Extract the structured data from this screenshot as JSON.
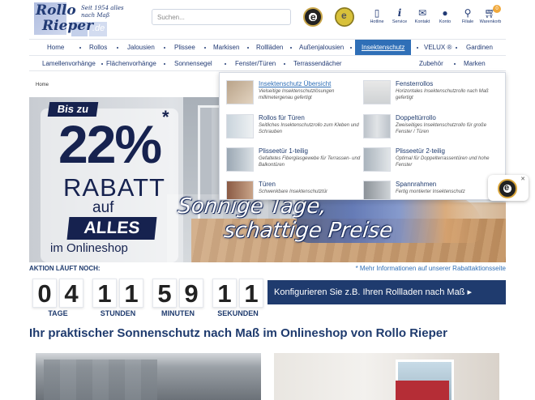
{
  "header": {
    "logo_line1": "Rollo",
    "logo_line2": "Rieper",
    "logo_tld": ".de",
    "logo_since": "Seit 1954 alles nach Maß",
    "search_placeholder": "Suchen...",
    "icons": [
      {
        "icon": "phone-icon",
        "label": "Hotline"
      },
      {
        "icon": "info-icon",
        "label": "Service"
      },
      {
        "icon": "mail-icon",
        "label": "Kontakt"
      },
      {
        "icon": "user-icon",
        "label": "Konto"
      },
      {
        "icon": "location-pin-icon",
        "label": "Filiale"
      },
      {
        "icon": "cart-icon",
        "label": "Warenkorb"
      }
    ],
    "cart_count": "0"
  },
  "nav_main": [
    "Home",
    "Rollos",
    "Jalousien",
    "Plissee",
    "Markisen",
    "Rollläden",
    "Außenjalousien",
    "Insektenschutz",
    "VELUX ®",
    "Gardinen"
  ],
  "nav_sub": [
    "Lamellenvorhänge",
    "Flächenvorhänge",
    "Sonnensegel",
    "Fenster/Türen",
    "Terrassendächer",
    "Zubehör",
    "Marken"
  ],
  "breadcrumb": "Home",
  "dropdown": [
    {
      "title": "Insektenschutz Übersicht",
      "desc": "Vielseitige Insektenschutzlösungen millimetergenau gefertigt"
    },
    {
      "title": "Fensterrollos",
      "desc": "Horizontales Insektenschutzrollo nach Maß gefertigt"
    },
    {
      "title": "Rollos für Türen",
      "desc": "Seitliches Insektenschutzrollo zum Kleben und Schrauben"
    },
    {
      "title": "Doppeltürrollo",
      "desc": "Zweiseitiges Insektenschutzrollo für große Fenster / Türen"
    },
    {
      "title": "Plisseetür 1-teilig",
      "desc": "Gefaltetes Fiberglasgewebe für Terrassen- und Balkontüren"
    },
    {
      "title": "Plisseetür 2-teilig",
      "desc": "Optimal für Doppelterrassentüren und hohe Fenster"
    },
    {
      "title": "Türen",
      "desc": "Schwenkbare Insektenschutztür"
    },
    {
      "title": "Spannrahmen",
      "desc": "Fertig montierter Insektenschutz"
    }
  ],
  "banner": {
    "bis_zu": "Bis zu",
    "percent": "22%",
    "asterisk": "*",
    "rabatt": "RABATT",
    "auf": "auf",
    "alles": "ALLES",
    "online": "im Onlineshop",
    "slogan1": "Sonnige Tage,",
    "slogan2": "schattige Preise"
  },
  "countdown": {
    "label": "AKTION LÄUFT NOCH:",
    "link": "* Mehr Informationen auf unserer Rabattaktionsseite",
    "digits": [
      "0",
      "4",
      "1",
      "1",
      "5",
      "9",
      "1",
      "1"
    ],
    "units": [
      "TAGE",
      "STUNDEN",
      "MINUTEN",
      "SEKUNDEN"
    ]
  },
  "config_button": "Konfigurieren Sie z.B. Ihren Rollladen nach Maß ▸",
  "headline": "Ihr praktischer Sonnenschutz nach Maß im Onlineshop von Rollo Rieper",
  "colors": {
    "primary": "#1f3b6e",
    "accent": "#2f6fb7",
    "cart_badge": "#f0a93c"
  }
}
